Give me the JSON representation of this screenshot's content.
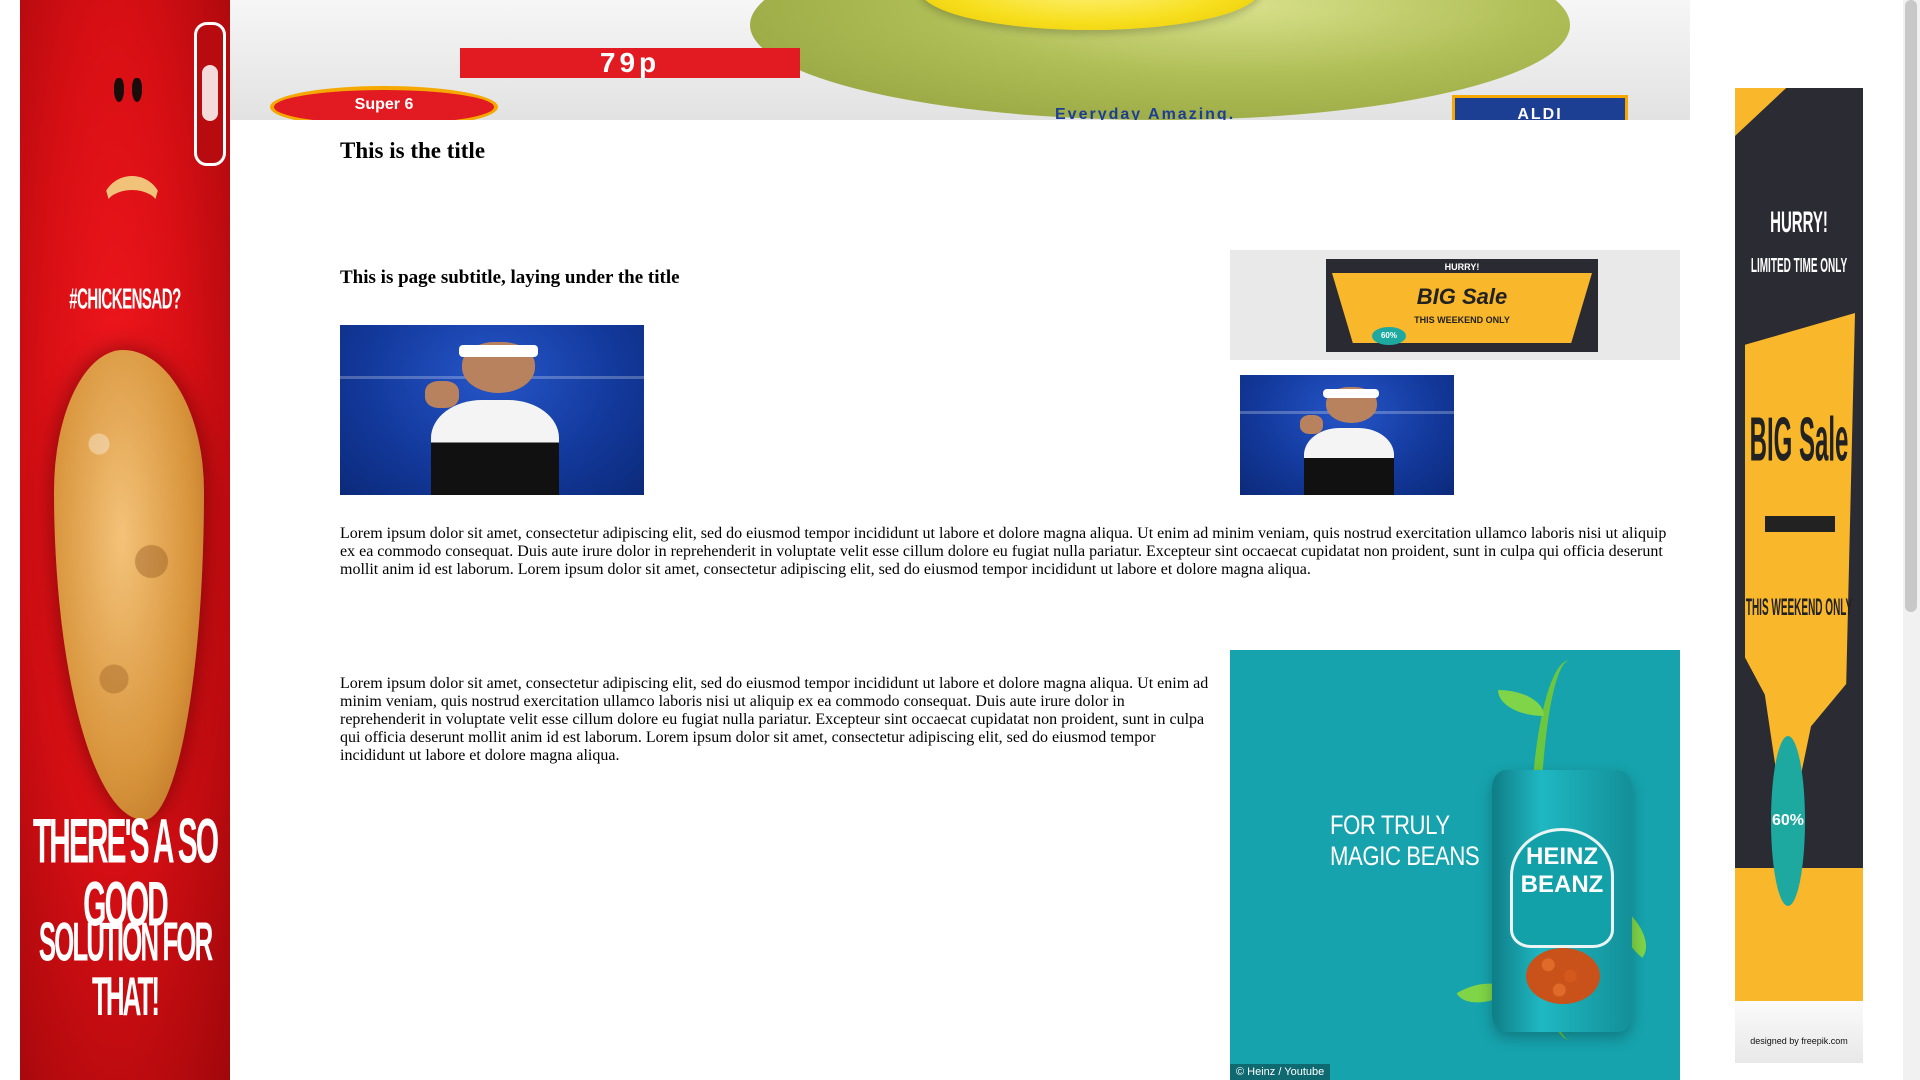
{
  "page": {
    "title": "This is the title",
    "subtitle": "This is page subtitle, laying under the title",
    "paragraph_1": "Lorem ipsum dolor sit amet, consectetur adipiscing elit, sed do eiusmod tempor incididunt ut labore et dolore magna aliqua. Ut enim ad minim veniam, quis nostrud exercitation ullamco laboris nisi ut aliquip ex ea commodo consequat. Duis aute irure dolor in reprehenderit in voluptate velit esse cillum dolore eu fugiat nulla pariatur. Excepteur sint occaecat cupidatat non proident, sunt in culpa qui officia deserunt mollit anim id est laborum. Lorem ipsum dolor sit amet, consectetur adipiscing elit, sed do eiusmod tempor incididunt ut labore et dolore magna aliqua.",
    "paragraph_2": "Lorem ipsum dolor sit amet, consectetur adipiscing elit, sed do eiusmod tempor incididunt ut labore et dolore magna aliqua. Ut enim ad minim veniam, quis nostrud exercitation ullamco laboris nisi ut aliquip ex ea commodo consequat. Duis aute irure dolor in reprehenderit in voluptate velit esse cillum dolore eu fugiat nulla pariatur. Excepteur sint occaecat cupidatat non proident, sunt in culpa qui officia deserunt mollit anim id est laborum. Lorem ipsum dolor sit amet, consectetur adipiscing elit, sed do eiusmod tempor incididunt ut labore et dolore magna aliqua."
  },
  "ads": {
    "left": {
      "hashtag": "#CHICKENSAD?",
      "slogan_line1": "THERE'S A SO GOOD",
      "slogan_line2": "SOLUTION FOR THAT!",
      "colors": {
        "background": "#d70f14",
        "text": "#ffffff"
      }
    },
    "top": {
      "price": "79p",
      "badge": "Super 6",
      "tagline": "Everyday Amazing.",
      "logo": "ALDI",
      "colors": {
        "brand_blue": "#1c3f94",
        "brand_red": "#e21b23",
        "brand_orange": "#f5a800"
      }
    },
    "content_sale": {
      "hurry": "HURRY!",
      "headline": "BIG Sale",
      "weekend": "THIS WEEKEND ONLY",
      "discount": "60%",
      "colors": {
        "accent": "#f9b72b",
        "dark": "#2a2a33",
        "teal": "#1ea9a0"
      }
    },
    "heinz": {
      "headline_line1": "FOR TRULY",
      "headline_line2": "MAGIC BEANS",
      "can_line1": "HEINZ",
      "can_line2": "BEANZ",
      "credit": "© Heinz / Youtube",
      "colors": {
        "background": "#16a3ad"
      }
    },
    "right": {
      "hurry": "HURRY!",
      "limited": "LIMITED TIME ONLY",
      "headline": "BIG Sale",
      "weekend": "THIS WEEKEND ONLY",
      "discount": "60%",
      "credit": "designed by freepik.com",
      "colors": {
        "accent": "#f9b72b",
        "dark": "#2b2b33",
        "teal": "#1ea9a0"
      }
    }
  },
  "icons": {
    "photo_left": "tennis-player-photo",
    "photo_right": "tennis-player-photo"
  }
}
